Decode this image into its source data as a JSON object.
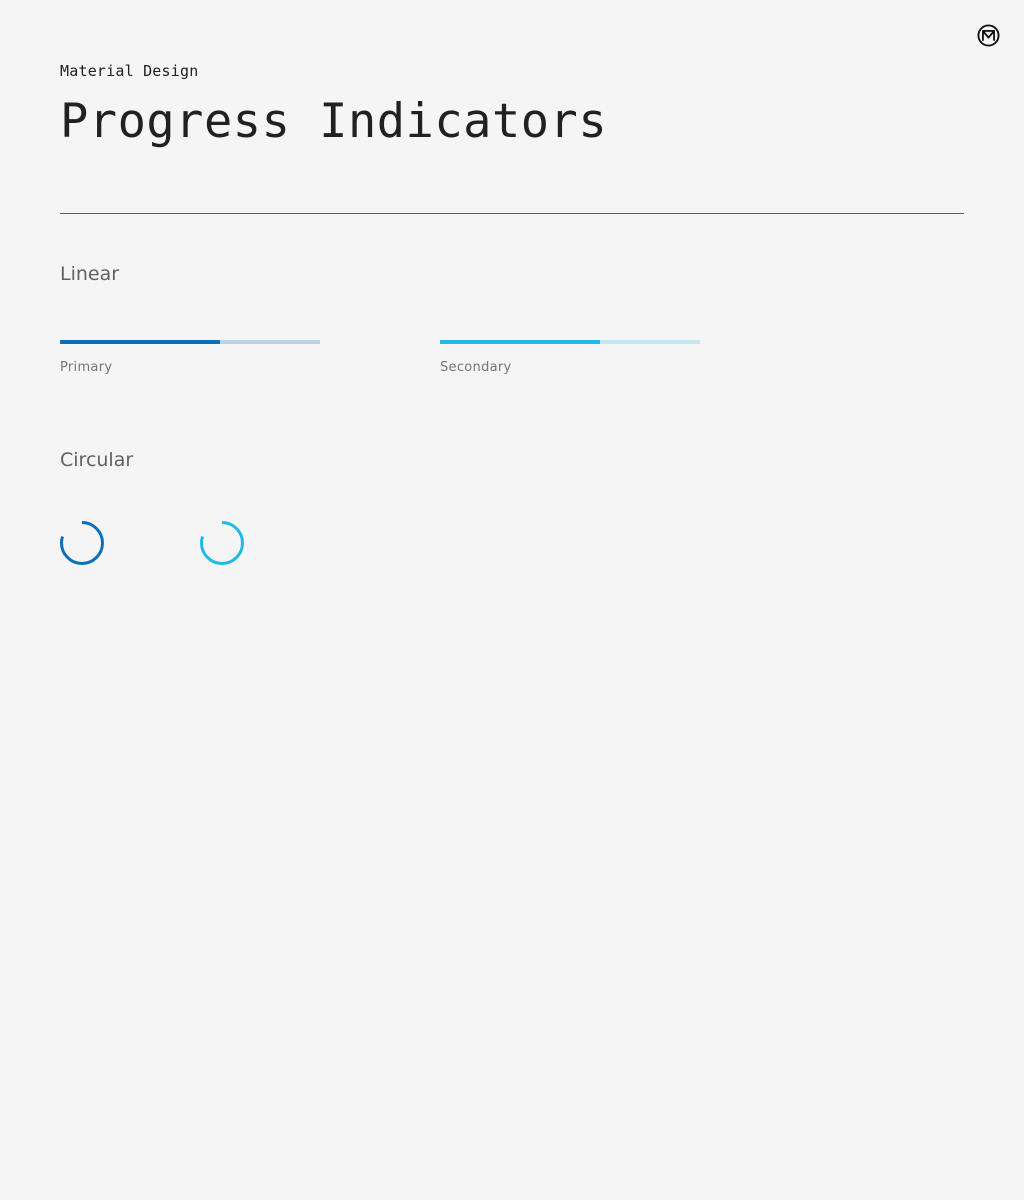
{
  "header": {
    "eyebrow": "Material Design",
    "title": "Progress Indicators",
    "logo_icon": "material-m-logo-icon"
  },
  "linear": {
    "heading": "Linear",
    "indicators": [
      {
        "label": "Primary",
        "progress": 0.615,
        "bar_color": "#0d6fb8",
        "track_color": "#b9d3e7"
      },
      {
        "label": "Secondary",
        "progress": 0.615,
        "bar_color": "#1ebbe7",
        "track_color": "#c4e9f5"
      }
    ]
  },
  "circular": {
    "heading": "Circular",
    "indicators": [
      {
        "name": "primary",
        "arc_fraction": 0.8,
        "color": "#0d6fb8"
      },
      {
        "name": "secondary",
        "arc_fraction": 0.8,
        "color": "#1ebbe7"
      }
    ]
  }
}
